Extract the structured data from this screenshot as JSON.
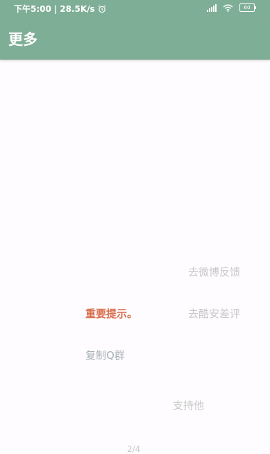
{
  "status_bar": {
    "time": "下午5:00",
    "separator": "|",
    "speed": "28.5K/s",
    "battery": "60",
    "icons": [
      "alarm-icon",
      "signal-icon",
      "wifi-icon",
      "battery-icon"
    ]
  },
  "app_bar": {
    "title": "更多"
  },
  "items": {
    "weibo_feedback": "去微博反馈",
    "important_notice": "重要提示。",
    "coolapk_review": "去酷安差评",
    "copy_qq_group": "复制Q群",
    "support": "支持他"
  },
  "page_indicator": "2/4",
  "colors": {
    "primary": "#7fae96",
    "accent": "#d96f4e",
    "muted": "#c8c8c8",
    "background": "#fefcfe"
  }
}
